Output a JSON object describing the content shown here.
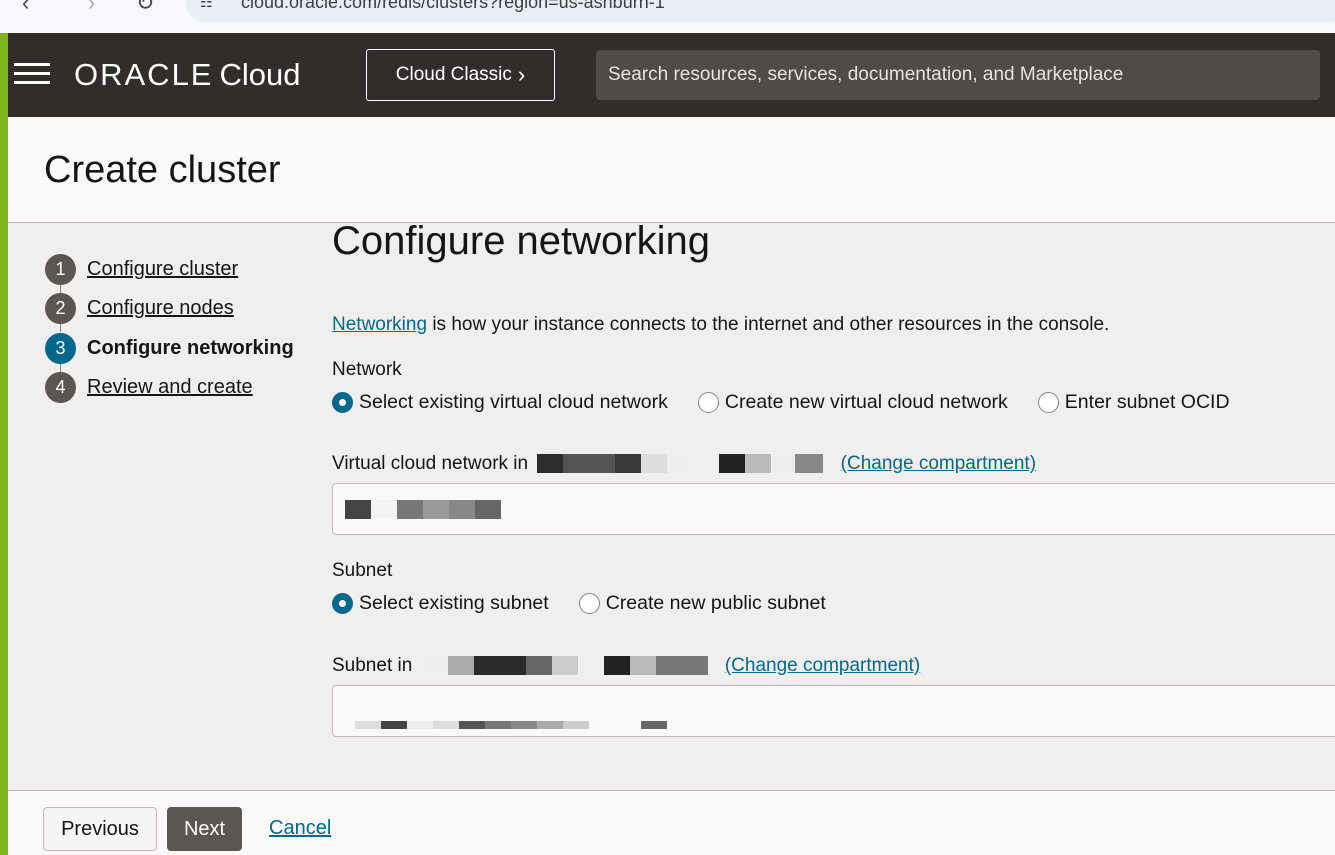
{
  "browser": {
    "url": "cloud.oracle.com/redis/clusters?region=us-ashburn-1"
  },
  "header": {
    "brand": "ORACLE",
    "brand_suffix": "Cloud",
    "classic_button": "Cloud Classic",
    "search_placeholder": "Search resources, services, documentation, and Marketplace"
  },
  "page": {
    "title": "Create cluster"
  },
  "steps": [
    {
      "number": "1",
      "label": "Configure cluster"
    },
    {
      "number": "2",
      "label": "Configure nodes"
    },
    {
      "number": "3",
      "label": "Configure networking"
    },
    {
      "number": "4",
      "label": "Review and create"
    }
  ],
  "form": {
    "section_title": "Configure networking",
    "intro_link": "Networking",
    "intro_text": " is how your instance connects to the internet and other resources in the console.",
    "network_label": "Network",
    "network_options": [
      "Select existing virtual cloud network",
      "Create new virtual cloud network",
      "Enter subnet OCID"
    ],
    "vcn_label": "Virtual cloud network in",
    "change_compartment": "(Change compartment)",
    "subnet_label": "Subnet",
    "subnet_options": [
      "Select existing subnet",
      "Create new public subnet"
    ],
    "subnet_in_label": "Subnet in"
  },
  "footer": {
    "previous": "Previous",
    "next": "Next",
    "cancel": "Cancel"
  },
  "colors": {
    "accent": "#00688c",
    "header_bg": "#312d2a",
    "left_bar": "#7cb518"
  }
}
